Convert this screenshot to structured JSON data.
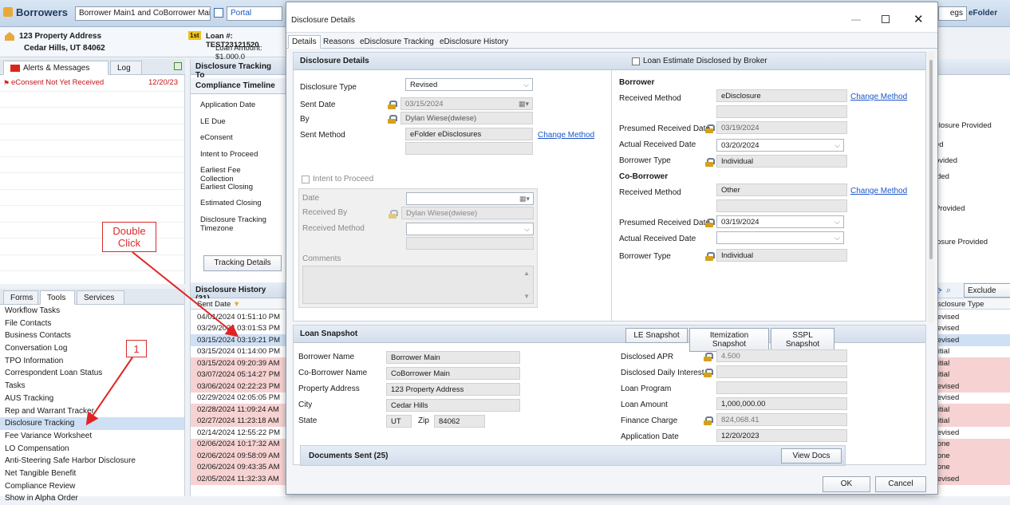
{
  "topbar": {
    "title": "Borrowers",
    "borrower_combo": "Borrower Main1 and CoBorrower Main",
    "portal_btn": "Portal",
    "right1": "egs",
    "right2": "eFolder"
  },
  "info": {
    "address1": "123 Property Address",
    "address2": "Cedar Hills, UT 84062",
    "badge": "1st",
    "loan_no": "Loan #: TEST23121520",
    "loan_amt": "Loan Amount: $1,000,0"
  },
  "left_tabs": {
    "alerts": "Alerts & Messages",
    "log": "Log"
  },
  "alert": {
    "text": "eConsent Not Yet Received",
    "date": "12/20/23"
  },
  "tools_tabs": {
    "forms": "Forms",
    "tools": "Tools",
    "services": "Services"
  },
  "tools": [
    "Workflow Tasks",
    "File Contacts",
    "Business Contacts",
    "Conversation Log",
    "TPO Information",
    "Correspondent Loan Status",
    "Tasks",
    "AUS Tracking",
    "Rep and Warrant Tracker",
    "Disclosure Tracking",
    "Fee Variance Worksheet",
    "LO Compensation",
    "Anti-Steering Safe Harbor Disclosure",
    "Net Tangible Benefit",
    "Compliance Review",
    "Show in Alpha Order"
  ],
  "mid": {
    "tab_title": "Disclosure Tracking To",
    "timeline_hdr": "Compliance Timeline",
    "timeline": [
      "Application Date",
      "LE Due",
      "eConsent",
      "Intent to Proceed",
      "Earliest Fee Collection",
      "Earliest Closing",
      "Estimated Closing",
      "Disclosure Tracking Timezone"
    ],
    "tracking_btn": "Tracking Details",
    "history_hdr": "Disclosure History (31)",
    "sent_col": "Sent Date"
  },
  "history": [
    "04/01/2024 01:51:10 PM",
    "03/29/2024 03:01:53 PM",
    "03/15/2024 03:19:21 PM",
    "03/15/2024 01:14:00 PM",
    "03/15/2024 09:20:39 AM",
    "03/07/2024 05:14:27 PM",
    "03/06/2024 02:22:23 PM",
    "02/29/2024 02:05:05 PM",
    "02/28/2024 11:09:24 AM",
    "02/27/2024 11:23:18 AM",
    "02/14/2024 12:55:22 PM",
    "02/06/2024 10:17:32 AM",
    "02/06/2024 09:58:09 AM",
    "02/06/2024 09:43:35 AM",
    "02/05/2024 11:32:33 AM"
  ],
  "right": {
    "items": [
      "closure Provided",
      "ed",
      "ovided",
      "ided",
      "Provided",
      "losure Provided"
    ],
    "exclude": "Exclude",
    "dt_col": "Disclosure Type",
    "types": [
      "Revised",
      "Revised",
      "Revised",
      "Initial",
      "Initial",
      "Initial",
      "Revised",
      "Revised",
      "Initial",
      "Initial",
      "Revised",
      "None",
      "None",
      "None",
      "Revised"
    ]
  },
  "annot": {
    "dbl": "Double Click",
    "one": "1"
  },
  "dialog": {
    "title": "Disclosure Details",
    "tabs": [
      "Details",
      "Reasons",
      "eDisclosure Tracking",
      "eDisclosure History"
    ],
    "sec_hdr": "Disclosure Details",
    "le_broker": "Loan Estimate Disclosed by Broker",
    "disc_type_lbl": "Disclosure Type",
    "disc_type": "Revised",
    "sent_date_lbl": "Sent Date",
    "sent_date": "03/15/2024",
    "by_lbl": "By",
    "by": "Dylan Wiese(dwiese)",
    "sent_method_lbl": "Sent Method",
    "sent_method": "eFolder eDisclosures",
    "change_method": "Change Method",
    "itp_lbl": "Intent to Proceed",
    "date_lbl": "Date",
    "recv_by_lbl": "Received By",
    "recv_by": "Dylan Wiese(dwiese)",
    "recv_method_lbl": "Received Method",
    "comments_lbl": "Comments",
    "borrower_hdr": "Borrower",
    "b_recv_method_lbl": "Received Method",
    "b_recv_method": "eDisclosure",
    "presumed_lbl": "Presumed Received Date",
    "b_presumed": "03/19/2024",
    "actual_lbl": "Actual Received Date",
    "b_actual": "03/20/2024",
    "btype_lbl": "Borrower Type",
    "b_type": "Individual",
    "coborrower_hdr": "Co-Borrower",
    "c_recv_method": "Other",
    "c_presumed": "03/19/2024",
    "c_type": "Individual",
    "snapshot_hdr": "Loan Snapshot",
    "le_snap": "LE Snapshot",
    "item_snap": "Itemization Snapshot",
    "sspl_snap": "SSPL Snapshot",
    "bname_lbl": "Borrower Name",
    "bname": "Borrower Main",
    "cname_lbl": "Co-Borrower Name",
    "cname": "CoBorrower Main",
    "paddr_lbl": "Property Address",
    "paddr": "123 Property Address",
    "city_lbl": "City",
    "city": "Cedar Hills",
    "state_lbl": "State",
    "state": "UT",
    "zip_lbl": "Zip",
    "zip": "84062",
    "apr_lbl": "Disclosed APR",
    "apr": "4.500",
    "daily_lbl": "Disclosed Daily Interest",
    "lprog_lbl": "Loan Program",
    "lamt_lbl": "Loan Amount",
    "lamt": "1,000,000.00",
    "fin_lbl": "Finance Charge",
    "fin": "824,068.41",
    "app_lbl": "Application Date",
    "app": "12/20/2023",
    "docs_hdr": "Documents Sent (25)",
    "view_docs": "View Docs",
    "ok": "OK",
    "cancel": "Cancel"
  }
}
